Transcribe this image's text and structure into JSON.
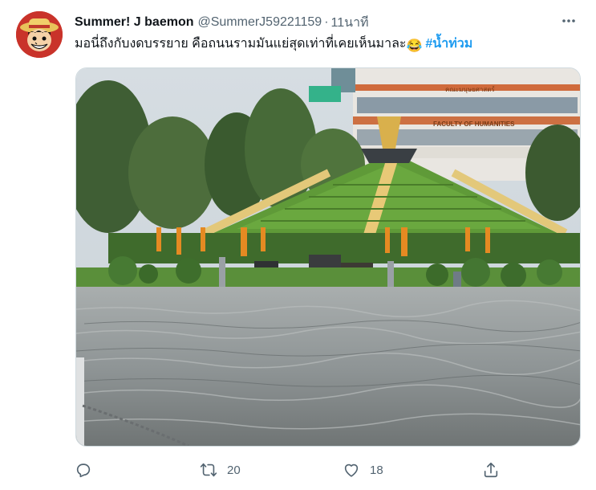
{
  "tweet": {
    "display_name": "Summer! J baemon",
    "handle": "@SummerJ59221159",
    "separator": "·",
    "time": "11นาที",
    "text": "มอนี่ถึงกับงดบรรยาย คือถนนรามมันแย่สุดเท่าที่เคยเห็นมาละ",
    "emoji": "😂",
    "hashtag": "#น้ำท่วม",
    "more_icon": "more-horizontal-icon"
  },
  "media": {
    "building_sign_en": "FACULTY OF HUMANITIES",
    "building_sign_th": "คณะมนุษยศาสตร์"
  },
  "actions": {
    "reply": {
      "icon": "reply-icon",
      "count": ""
    },
    "retweet": {
      "icon": "retweet-icon",
      "count": "20"
    },
    "like": {
      "icon": "heart-icon",
      "count": "18"
    },
    "share": {
      "icon": "share-icon",
      "count": ""
    }
  },
  "colors": {
    "accent": "#1d9bf0",
    "muted": "#536471",
    "text": "#0f1419"
  }
}
